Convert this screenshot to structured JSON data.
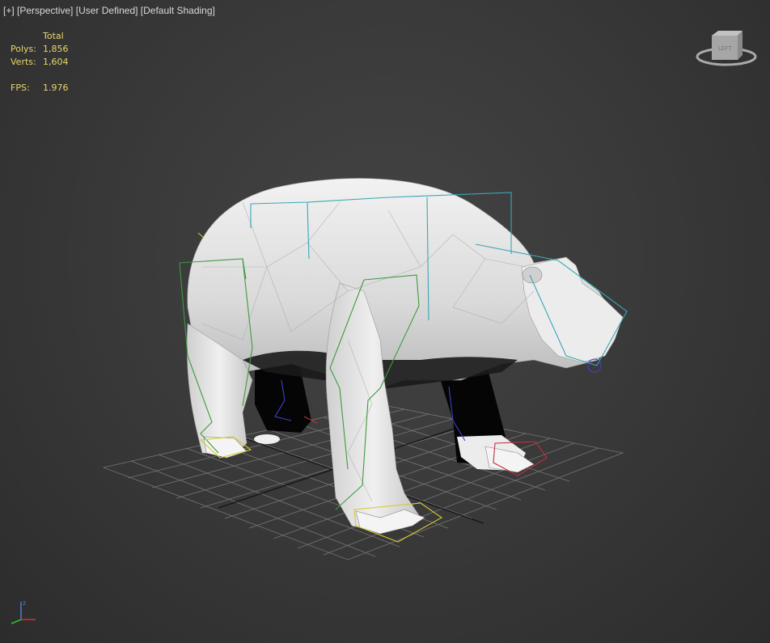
{
  "viewport": {
    "labels": [
      "[+]",
      "[Perspective]",
      "[User Defined]",
      "[Default Shading]"
    ]
  },
  "stats": {
    "header": "Total",
    "polys_label": "Polys:",
    "polys_value": "1,856",
    "verts_label": "Verts:",
    "verts_value": "1,604",
    "fps_label": "FPS:",
    "fps_value": "1.976"
  },
  "viewcube": {
    "icon": "viewcube-icon"
  },
  "axis_gizmo": {
    "z_label": "z",
    "axis_colors": {
      "x": "#d03030",
      "y": "#30c030",
      "z": "#4a7bd8"
    }
  },
  "scene": {
    "object": "polar bear low-poly mesh with bone rig",
    "colors": {
      "mesh": "#e6e6e6",
      "bone_cyan": "#3aa6b8",
      "bone_green": "#3f9a3f",
      "bone_yellow": "#d8c830",
      "bone_blue": "#4040c8",
      "bone_red": "#c03040",
      "grid": "#8a8a8a"
    }
  }
}
